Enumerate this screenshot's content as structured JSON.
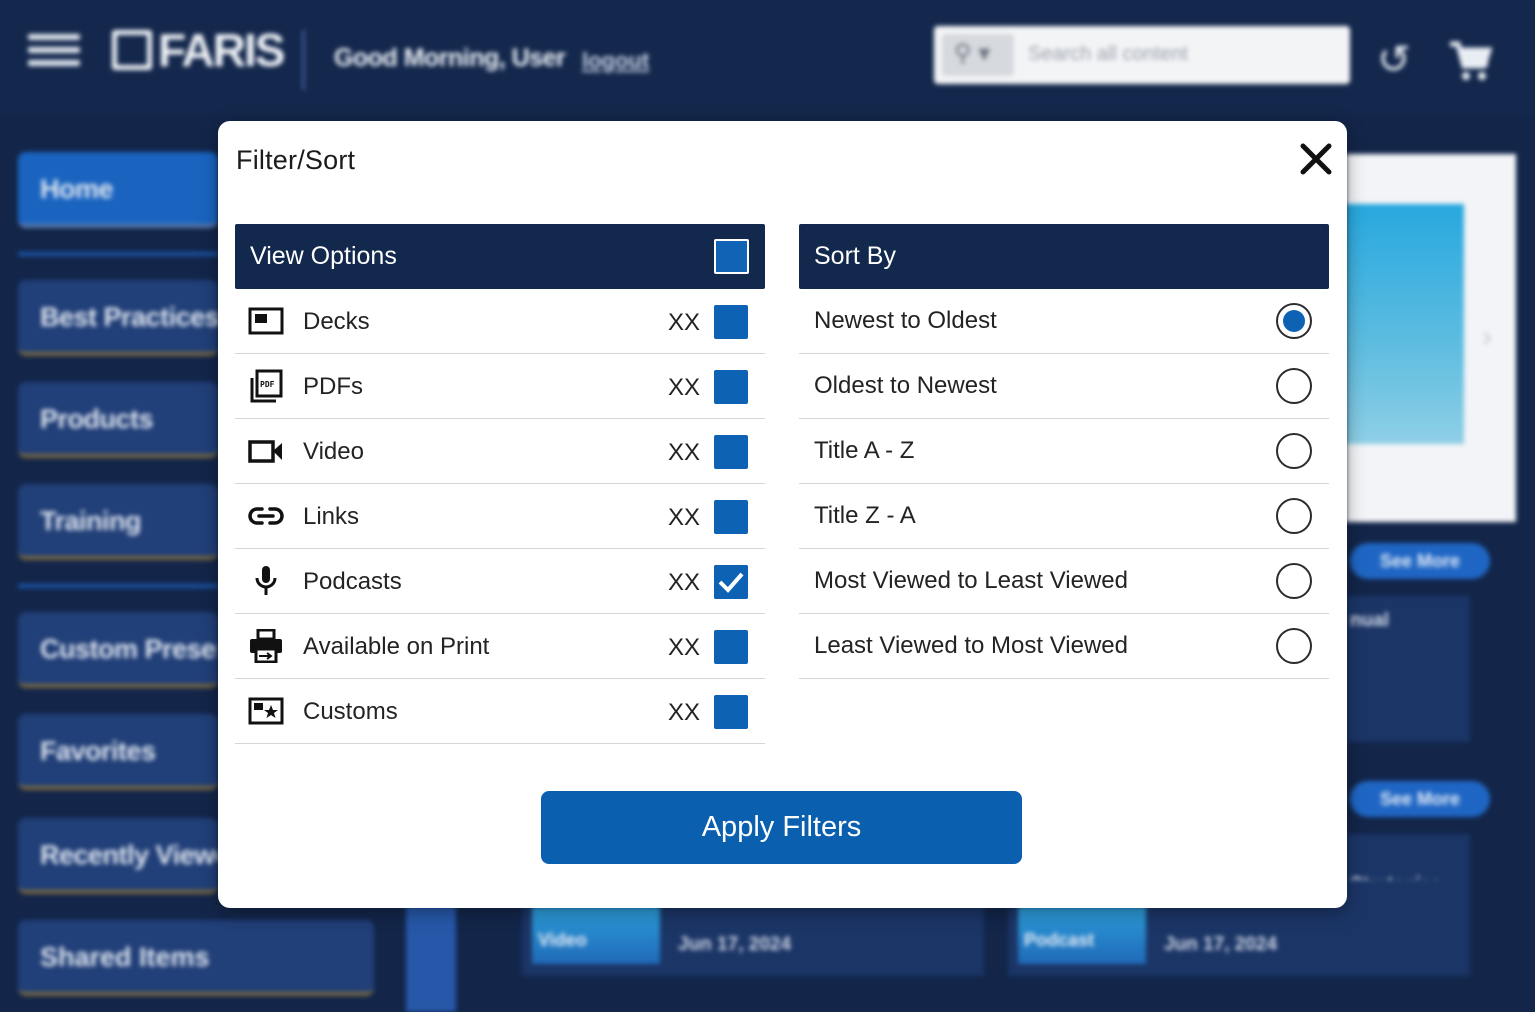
{
  "header": {
    "brand": "FARIS",
    "greeting": "Good Morning, User",
    "logout_label": "logout",
    "search_placeholder": "Search all content"
  },
  "sidebar": {
    "items": [
      {
        "label": "Home"
      },
      {
        "label": "Best Practices"
      },
      {
        "label": "Products"
      },
      {
        "label": "Training"
      },
      {
        "label": "Custom Presentations"
      },
      {
        "label": "Favorites"
      },
      {
        "label": "Recently Viewed"
      },
      {
        "label": "Shared Items"
      }
    ]
  },
  "background": {
    "see_more_1": "See More",
    "see_more_2": "See More",
    "right_text_1": "nual",
    "right_text_2": "Strategies",
    "card_1": {
      "type": "Video",
      "date": "Jun 17, 2024"
    },
    "card_2": {
      "type": "Podcast",
      "date": "Jun 17, 2024"
    }
  },
  "modal": {
    "title": "Filter/Sort",
    "view_options": {
      "heading": "View Options",
      "select_all_checked": false,
      "items": [
        {
          "label": "Decks",
          "count": "XX",
          "icon": "deck-icon",
          "checked": false
        },
        {
          "label": "PDFs",
          "count": "XX",
          "icon": "pdf-icon",
          "checked": false
        },
        {
          "label": "Video",
          "count": "XX",
          "icon": "video-icon",
          "checked": false
        },
        {
          "label": "Links",
          "count": "XX",
          "icon": "link-icon",
          "checked": false
        },
        {
          "label": "Podcasts",
          "count": "XX",
          "icon": "microphone-icon",
          "checked": true
        },
        {
          "label": "Available on Print",
          "count": "XX",
          "icon": "print-icon",
          "checked": false
        },
        {
          "label": "Customs",
          "count": "XX",
          "icon": "custom-star-icon",
          "checked": false
        }
      ]
    },
    "sort_by": {
      "heading": "Sort By",
      "selected": "Newest to Oldest",
      "options": [
        {
          "label": "Newest to Oldest",
          "selected": true
        },
        {
          "label": "Oldest to Newest",
          "selected": false
        },
        {
          "label": "Title A - Z",
          "selected": false
        },
        {
          "label": "Title Z - A",
          "selected": false
        },
        {
          "label": "Most Viewed to Least Viewed",
          "selected": false
        },
        {
          "label": "Least Viewed to Most Viewed",
          "selected": false
        }
      ]
    },
    "apply_label": "Apply Filters"
  },
  "colors": {
    "accent": "#0d62b3",
    "header_navy": "#12284d",
    "page_bg": "#13264a"
  }
}
